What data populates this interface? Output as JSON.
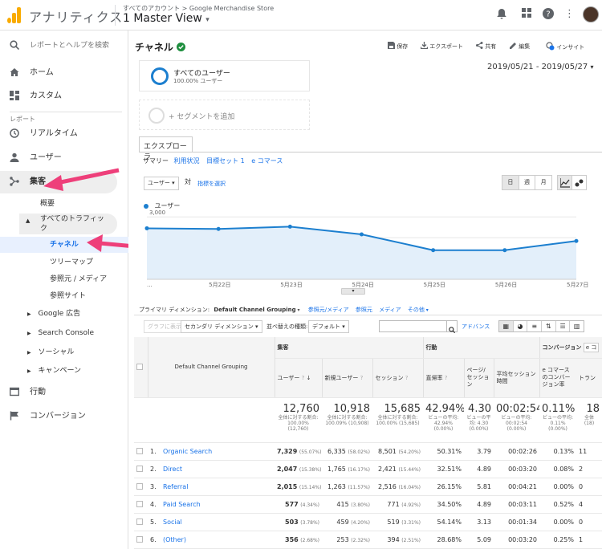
{
  "app": {
    "name": "アナリティクス",
    "account_path": "すべてのアカウント > Google Merchandise Store",
    "view": "1 Master View"
  },
  "colors": {
    "accent": "#1a73e8",
    "line": "#1c7fcf",
    "fill": "#e3effa",
    "arrow": "#ee3f7a",
    "logo": "#f9ab00",
    "green": "#1e8e3e"
  },
  "sidebar": {
    "search": "レポートとヘルプを検索",
    "home": "ホーム",
    "custom": "カスタム",
    "section": "レポート",
    "realtime": "リアルタイム",
    "audience": "ユーザー",
    "acquisition": "集客",
    "overview": "概要",
    "all_traffic": "すべてのトラフィック",
    "channels": "チャネル",
    "treemap": "ツリーマップ",
    "source_medium": "参照元 / メディア",
    "referrals": "参照サイト",
    "google_ads": "Google 広告",
    "search_console": "Search Console",
    "social": "ソーシャル",
    "campaigns": "キャンペーン",
    "behavior": "行動",
    "conversions": "コンバージョン"
  },
  "header": {
    "title": "チャネル",
    "save": "保存",
    "export": "エクスポート",
    "share": "共有",
    "edit": "編集",
    "insight": "インサイト"
  },
  "segments": {
    "all_users": "すべてのユーザー",
    "all_users_pct": "100.00% ユーザー",
    "add": "+ セグメントを追加"
  },
  "date_range": "2019/05/21 - 2019/05/27",
  "explorer": {
    "tab": "エクスプローラ",
    "subtabs": [
      "サマリー",
      "利用状況",
      "目標セット 1",
      "e コマース"
    ]
  },
  "metric": {
    "select": "ユーザー",
    "vs": "対",
    "pick": "指標を選択",
    "day": "日",
    "week": "週",
    "month": "月",
    "legend": "ユーザー"
  },
  "chart_data": {
    "type": "line",
    "x": [
      "5/21",
      "5/22",
      "5/23",
      "5/24",
      "5/25",
      "5/26",
      "5/27"
    ],
    "tick_labels": [
      "...",
      "5月22日",
      "5月23日",
      "5月24日",
      "5月25日",
      "5月26日",
      "5月27日"
    ],
    "series": [
      {
        "name": "ユーザー",
        "values": [
          2450,
          2420,
          2530,
          2160,
          1400,
          1400,
          1840
        ]
      }
    ],
    "yticks": [
      "3,000",
      "2,000",
      "1,000"
    ],
    "ylim": [
      0,
      3200
    ]
  },
  "dims": {
    "label": "プライマリ ディメンション:",
    "active": "Default Channel Grouping",
    "others": [
      "参照元/メディア",
      "参照元",
      "メディア",
      "その他"
    ]
  },
  "toolbar": {
    "plot": "グラフに表示",
    "secondary": "セカンダリ ディメンション",
    "sort_label": "並べ替えの種類:",
    "sort": "デフォルト",
    "advanced": "アドバンス"
  },
  "table": {
    "dim_header": "Default Channel Grouping",
    "groups": {
      "acq": "集客",
      "beh": "行動",
      "conv": "コンバージョン",
      "ecomm_dd": "e コ"
    },
    "headers": {
      "users": "ユーザー",
      "new_users": "新規ユーザー",
      "sessions": "セッション",
      "bounce": "直帰率",
      "pps": "ページ/セッション",
      "avg": "平均セッション時間",
      "ecr": "e コマースのコンバージョン率",
      "tx": "トラン"
    },
    "totals": {
      "users": "12,760",
      "users_sub": "全体に対する割合: 100.00% (12,760)",
      "new_users": "10,918",
      "new_sub": "全体に対する割合: 100.09% (10,908)",
      "sessions": "15,685",
      "sess_sub": "全体に対する割合: 100.00% (15,685)",
      "bounce": "42.94%",
      "bounce_sub": "ビューの平均: 42.94% (0.00%)",
      "pps": "4.30",
      "pps_sub": "ビューの平均: 4.30 (0.00%)",
      "avg": "00:02:54",
      "avg_sub": "ビューの平均: 00:02:54 (0.00%)",
      "ecr": "0.11%",
      "ecr_sub": "ビューの平均: 0.11% (0.00%)",
      "tx": "18",
      "tx_sub": "全体 (18)"
    },
    "rows": [
      {
        "n": "1.",
        "name": "Organic Search",
        "users": "7,329",
        "up": "(55.07%)",
        "new": "6,335",
        "np": "(58.02%)",
        "sess": "8,501",
        "sp": "(54.20%)",
        "bounce": "50.31%",
        "pps": "3.79",
        "avg": "00:02:26",
        "ecr": "0.13%",
        "tx": "11"
      },
      {
        "n": "2.",
        "name": "Direct",
        "users": "2,047",
        "up": "(15.38%)",
        "new": "1,765",
        "np": "(16.17%)",
        "sess": "2,421",
        "sp": "(15.44%)",
        "bounce": "32.51%",
        "pps": "4.89",
        "avg": "00:03:20",
        "ecr": "0.08%",
        "tx": "2"
      },
      {
        "n": "3.",
        "name": "Referral",
        "users": "2,015",
        "up": "(15.14%)",
        "new": "1,263",
        "np": "(11.57%)",
        "sess": "2,516",
        "sp": "(16.04%)",
        "bounce": "26.15%",
        "pps": "5.81",
        "avg": "00:04:21",
        "ecr": "0.00%",
        "tx": "0"
      },
      {
        "n": "4.",
        "name": "Paid Search",
        "users": "577",
        "up": "(4.34%)",
        "new": "415",
        "np": "(3.80%)",
        "sess": "771",
        "sp": "(4.92%)",
        "bounce": "34.50%",
        "pps": "4.89",
        "avg": "00:03:11",
        "ecr": "0.52%",
        "tx": "4"
      },
      {
        "n": "5.",
        "name": "Social",
        "users": "503",
        "up": "(3.78%)",
        "new": "459",
        "np": "(4.20%)",
        "sess": "519",
        "sp": "(3.31%)",
        "bounce": "54.14%",
        "pps": "3.13",
        "avg": "00:01:34",
        "ecr": "0.00%",
        "tx": "0"
      },
      {
        "n": "6.",
        "name": "(Other)",
        "users": "356",
        "up": "(2.68%)",
        "new": "253",
        "np": "(2.32%)",
        "sess": "394",
        "sp": "(2.51%)",
        "bounce": "28.68%",
        "pps": "5.09",
        "avg": "00:03:20",
        "ecr": "0.25%",
        "tx": "1"
      }
    ]
  }
}
